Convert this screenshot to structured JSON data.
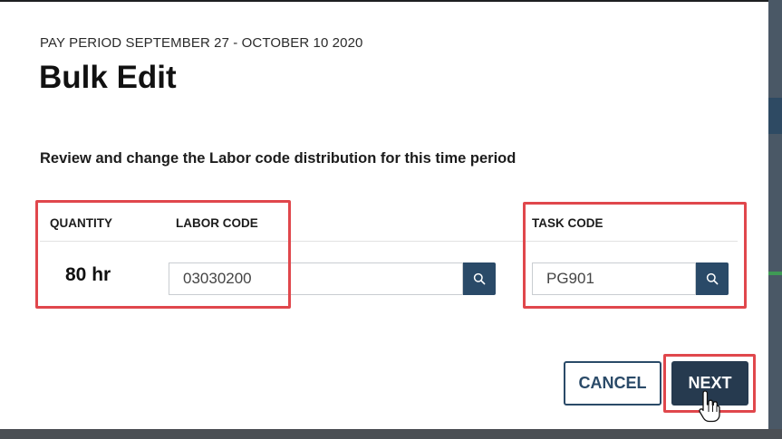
{
  "modal": {
    "subtitle": "PAY PERIOD SEPTEMBER 27 - OCTOBER 10 2020",
    "title": "Bulk Edit",
    "description": "Review and change the Labor code distribution for this time period"
  },
  "table": {
    "headers": {
      "quantity": "QUANTITY",
      "labor_code": "LABOR CODE",
      "task_code": "TASK CODE"
    },
    "row": {
      "quantity": "80 hr",
      "labor_code": "03030200",
      "task_code": "PG901"
    }
  },
  "actions": {
    "cancel_label": "CANCEL",
    "next_label": "NEXT"
  },
  "colors": {
    "primary": "#2a4a68",
    "highlight": "#e0474c"
  },
  "icons": {
    "search": "search-icon",
    "cursor": "hand-pointer-cursor-icon"
  }
}
